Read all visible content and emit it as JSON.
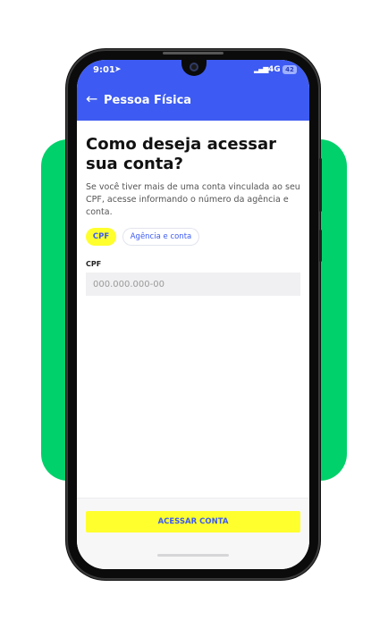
{
  "status_bar": {
    "time": "9:01",
    "network": "4G",
    "battery": "42"
  },
  "app_bar": {
    "back_icon": "arrow-left-icon",
    "title": "Pessoa Física"
  },
  "main": {
    "heading": "Como deseja acessar sua conta?",
    "description": "Se você tiver mais de uma conta vinculada ao seu CPF, acesse informando o número da agência e conta.",
    "options": [
      {
        "label": "CPF",
        "selected": true
      },
      {
        "label": "Agência e conta",
        "selected": false
      }
    ],
    "field_label": "CPF",
    "field_placeholder": "000.000.000-00",
    "field_value": ""
  },
  "footer": {
    "button_label": "ACESSAR CONTA"
  },
  "colors": {
    "brand_blue": "#3d5bf2",
    "accent_yellow": "#ffff2e",
    "background_green": "#00d16a"
  }
}
